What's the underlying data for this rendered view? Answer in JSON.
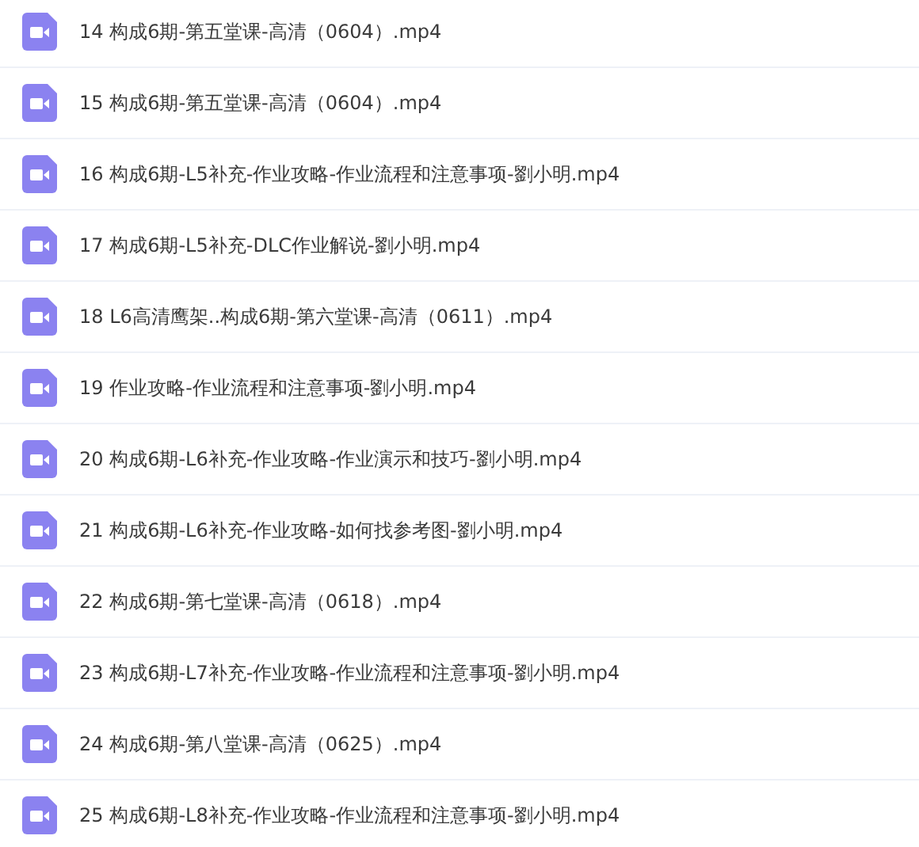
{
  "files": [
    {
      "name": "14 构成6期-第五堂课-高清（0604）.mp4",
      "kind": "video"
    },
    {
      "name": "15 构成6期-第五堂课-高清（0604）.mp4",
      "kind": "video"
    },
    {
      "name": "16 构成6期-L5补充-作业攻略-作业流程和注意事项-劉小明.mp4",
      "kind": "video"
    },
    {
      "name": "17 构成6期-L5补充-DLC作业解说-劉小明.mp4",
      "kind": "video"
    },
    {
      "name": "18 L6高清鹰架..构成6期-第六堂课-高清（0611）.mp4",
      "kind": "video"
    },
    {
      "name": "19 作业攻略-作业流程和注意事项-劉小明.mp4",
      "kind": "video"
    },
    {
      "name": "20 构成6期-L6补充-作业攻略-作业演示和技巧-劉小明.mp4",
      "kind": "video"
    },
    {
      "name": "21 构成6期-L6补充-作业攻略-如何找参考图-劉小明.mp4",
      "kind": "video"
    },
    {
      "name": "22 构成6期-第七堂课-高清（0618）.mp4",
      "kind": "video"
    },
    {
      "name": "23 构成6期-L7补充-作业攻略-作业流程和注意事项-劉小明.mp4",
      "kind": "video"
    },
    {
      "name": "24 构成6期-第八堂课-高清（0625）.mp4",
      "kind": "video"
    },
    {
      "name": "25 构成6期-L8补充-作业攻略-作业流程和注意事项-劉小明.mp4",
      "kind": "video"
    }
  ]
}
